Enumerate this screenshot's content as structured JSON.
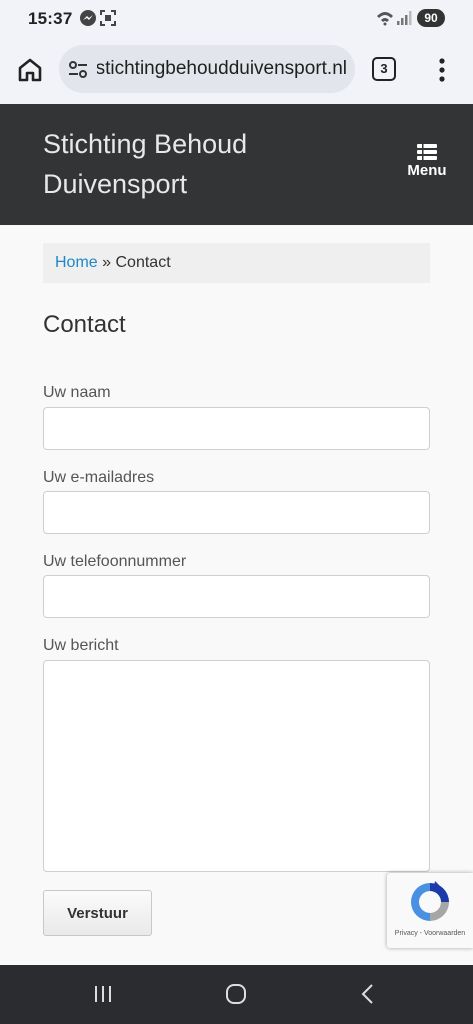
{
  "status_bar": {
    "time": "15:37",
    "battery": "90",
    "icons": [
      "messenger-icon",
      "screenshot-icon",
      "wifi-icon",
      "signal-icon"
    ]
  },
  "browser": {
    "url": "stichtingbehoudduivensport.nl",
    "tab_count": "3"
  },
  "site": {
    "title": "Stichting Behoud Duivensport",
    "menu_label": "Menu",
    "header_color": "#333436"
  },
  "breadcrumb": {
    "home": "Home",
    "separator": "»",
    "current": "Contact",
    "link_color": "#1e88c8"
  },
  "page": {
    "title": "Contact"
  },
  "form": {
    "name_label": "Uw naam",
    "email_label": "Uw e-mailadres",
    "phone_label": "Uw telefoonnummer",
    "message_label": "Uw bericht",
    "name_value": "",
    "email_value": "",
    "phone_value": "",
    "message_value": "",
    "submit_label": "Verstuur"
  },
  "recaptcha": {
    "links": "Privacy - Voorwaarden"
  }
}
